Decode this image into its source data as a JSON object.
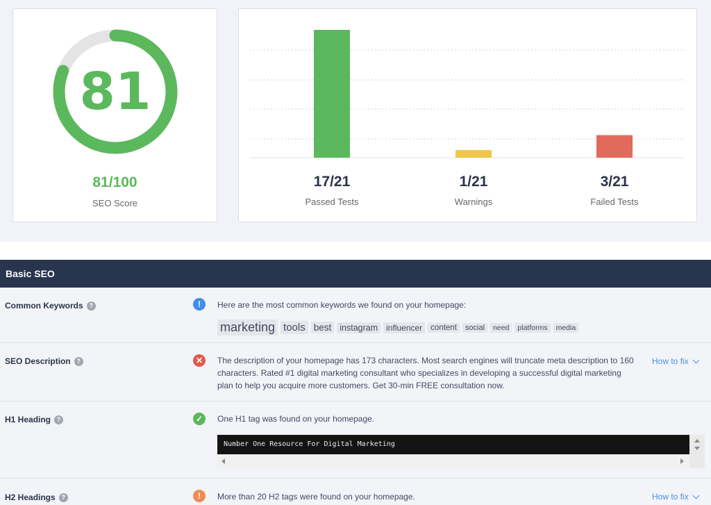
{
  "score": {
    "value": "81",
    "fraction": "81/100",
    "caption": "SEO Score",
    "percent": 81,
    "accent_color": "#5cb85c"
  },
  "tests": [
    {
      "value": "17/21",
      "label": "Passed Tests",
      "count": 17,
      "color": "#5cb85c"
    },
    {
      "value": "1/21",
      "label": "Warnings",
      "count": 1,
      "color": "#f0c74b"
    },
    {
      "value": "3/21",
      "label": "Failed Tests",
      "count": 3,
      "color": "#e06a5c"
    }
  ],
  "section_title": "Basic SEO",
  "rows": {
    "keywords": {
      "label": "Common Keywords",
      "help": "?",
      "status_icon": "info-icon",
      "text": "Here are the most common keywords we found on your homepage:",
      "keywords": [
        "marketing",
        "tools",
        "best",
        "instagram",
        "influencer",
        "content",
        "social",
        "need",
        "platforms",
        "media"
      ]
    },
    "description": {
      "label": "SEO Description",
      "help": "?",
      "status_icon": "cross-icon",
      "text": "The description of your homepage has 173 characters. Most search engines will truncate meta description to 160 characters. Rated #1 digital marketing consultant who specializes in developing a successful digital marketing plan to help you acquire more customers. Get 30-min FREE consultation now.",
      "howto": "How to fix"
    },
    "h1": {
      "label": "H1 Heading",
      "help": "?",
      "status_icon": "check-icon",
      "text": "One H1 tag was found on your homepage.",
      "code": "Number One Resource For Digital Marketing"
    },
    "h2": {
      "label": "H2 Headings",
      "help": "?",
      "status_icon": "warning-icon",
      "text": "More than 20 H2 tags were found on your homepage.",
      "howto": "How to fix"
    }
  }
}
